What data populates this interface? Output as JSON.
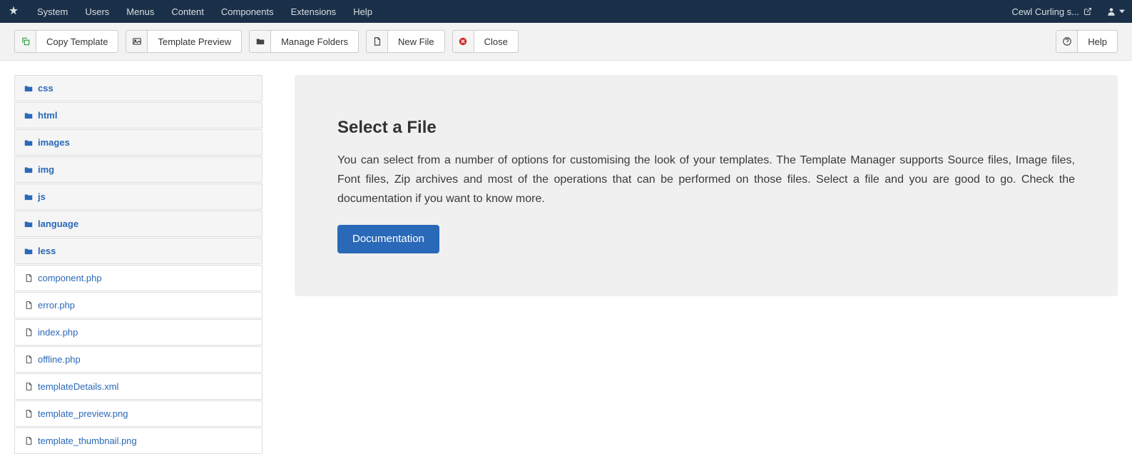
{
  "topnav": {
    "items": [
      "System",
      "Users",
      "Menus",
      "Content",
      "Components",
      "Extensions",
      "Help"
    ],
    "site_name": "Cewl Curling s..."
  },
  "toolbar": {
    "copy_template": "Copy Template",
    "template_preview": "Template Preview",
    "manage_folders": "Manage Folders",
    "new_file": "New File",
    "close": "Close",
    "help": "Help"
  },
  "tree": {
    "folders": [
      "css",
      "html",
      "images",
      "img",
      "js",
      "language",
      "less"
    ],
    "files": [
      "component.php",
      "error.php",
      "index.php",
      "offline.php",
      "templateDetails.xml",
      "template_preview.png",
      "template_thumbnail.png"
    ]
  },
  "content": {
    "heading": "Select a File",
    "description": "You can select from a number of options for customising the look of your templates. The Template Manager supports Source files, Image files, Font files, Zip archives and most of the operations that can be performed on those files. Select a file and you are good to go. Check the documentation if you want to know more.",
    "doc_button": "Documentation"
  }
}
